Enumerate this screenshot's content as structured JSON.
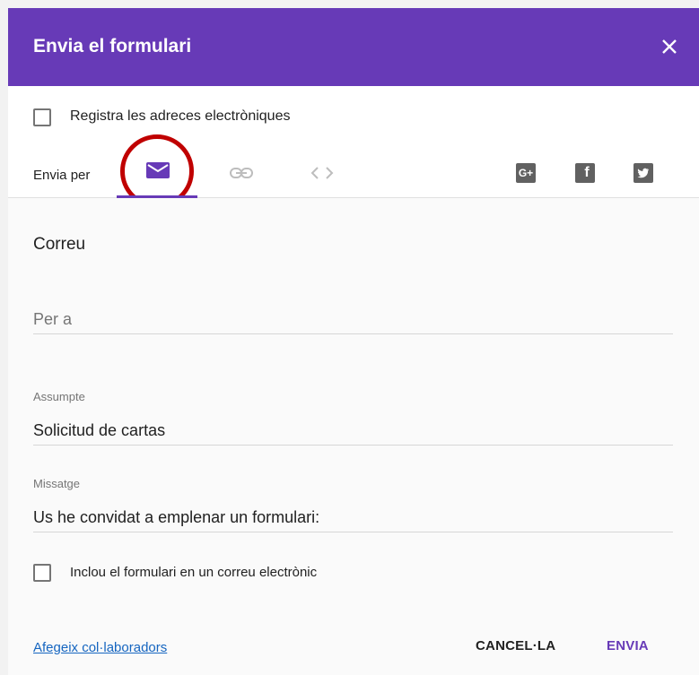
{
  "dialog": {
    "title": "Envia el formulari",
    "close_label": "×",
    "header_color": "#673ab7"
  },
  "options": {
    "collect_emails_label": "Registra les adreces electròniques",
    "collect_emails_checked": false
  },
  "send_via": {
    "label": "Envia per",
    "tabs": [
      {
        "name": "email",
        "icon": "envelope-icon",
        "active": true,
        "highlighted": true
      },
      {
        "name": "link",
        "icon": "link-icon",
        "active": false
      },
      {
        "name": "embed",
        "icon": "code-icon",
        "active": false
      }
    ],
    "social": [
      {
        "name": "google-plus",
        "icon": "google-plus-icon",
        "text": "G+"
      },
      {
        "name": "facebook",
        "icon": "facebook-icon",
        "text": "f"
      },
      {
        "name": "twitter",
        "icon": "twitter-icon"
      }
    ]
  },
  "email_form": {
    "section_title": "Correu",
    "to": {
      "placeholder": "Per a",
      "value": ""
    },
    "subject": {
      "label": "Assumpte",
      "value": "Solicitud de cartas"
    },
    "message": {
      "label": "Missatge",
      "value": "Us he convidat a emplenar un formulari:"
    },
    "include_form_label": "Inclou el formulari en un correu electrònic",
    "include_form_checked": false
  },
  "footer": {
    "collaborators_link": "Afegeix col·laboradors",
    "cancel_label": "CANCEL·LA",
    "send_label": "ENVIA"
  }
}
